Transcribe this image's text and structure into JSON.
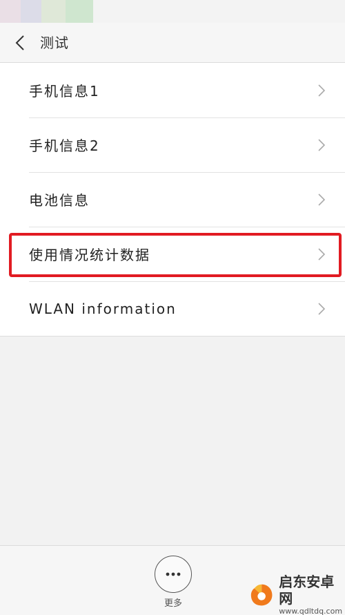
{
  "header": {
    "title": "测试",
    "back_icon": "chevron-left-icon"
  },
  "menu": {
    "items": [
      {
        "label": "手机信息1",
        "icon": "chevron-right-icon"
      },
      {
        "label": "手机信息2",
        "icon": "chevron-right-icon"
      },
      {
        "label": "电池信息",
        "icon": "chevron-right-icon"
      },
      {
        "label": "使用情况统计数据",
        "icon": "chevron-right-icon",
        "highlighted": true
      },
      {
        "label": "WLAN information",
        "icon": "chevron-right-icon"
      }
    ]
  },
  "bottom": {
    "more_label": "更多",
    "more_icon": "more-dots-icon"
  },
  "watermark": {
    "title": "启东安卓网",
    "url": "www.qdltdq.com"
  },
  "colors": {
    "highlight": "#e11b22",
    "background": "#f2f2f2",
    "list_bg": "#ffffff"
  }
}
